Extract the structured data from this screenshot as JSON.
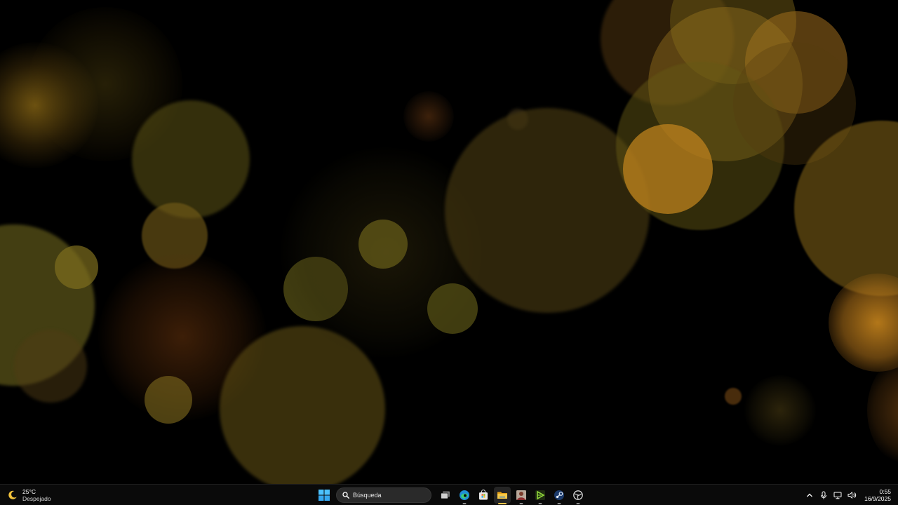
{
  "desktop": {
    "wallpaper": "golden bokeh lights on black",
    "colors": {
      "background": "#000000",
      "bokeh_olive": "#6b5a12",
      "bokeh_amber": "#c4841c",
      "bokeh_rust": "#7a3d10"
    }
  },
  "taskbar": {
    "weather": {
      "icon": "moon-icon",
      "temperature": "25°C",
      "condition": "Despejado"
    },
    "start": {
      "icon": "windows-start-icon"
    },
    "search": {
      "icon": "search-icon",
      "placeholder": "Búsqueda"
    },
    "apps": [
      {
        "name": "task-view",
        "icon": "task-view-icon",
        "active": false
      },
      {
        "name": "edge",
        "icon": "edge-icon",
        "active": false,
        "running": true
      },
      {
        "name": "store",
        "icon": "microsoft-store-icon",
        "active": false
      },
      {
        "name": "file-explorer",
        "icon": "folder-icon",
        "active": true,
        "running": true
      },
      {
        "name": "photo-app",
        "icon": "photo-app-icon",
        "active": false,
        "running": true
      },
      {
        "name": "media-app",
        "icon": "green-play-icon",
        "active": false,
        "running": true
      },
      {
        "name": "steam",
        "icon": "steam-icon",
        "active": false,
        "running": true
      },
      {
        "name": "app",
        "icon": "circular-app-icon",
        "active": false,
        "running": true
      }
    ],
    "tray": {
      "icons": [
        "chevron-up-icon",
        "microphone-icon",
        "network-icon",
        "volume-icon"
      ],
      "time": "0:55",
      "date": "16/9/2025"
    },
    "accent": "#f3c44a"
  }
}
